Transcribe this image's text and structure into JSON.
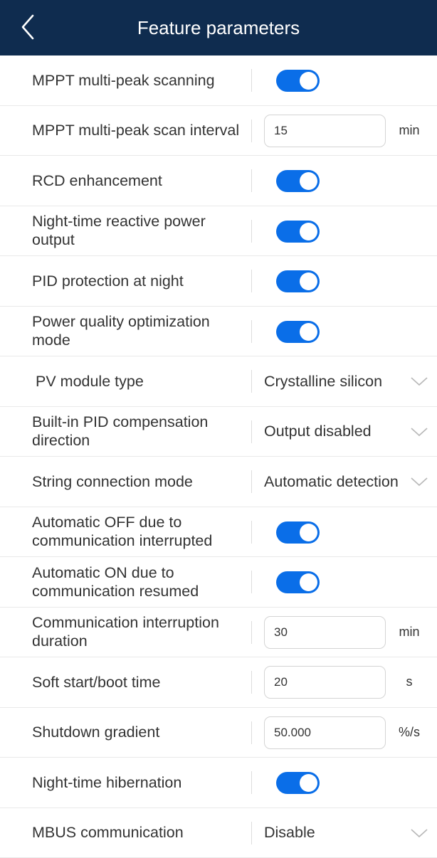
{
  "header": {
    "title": "Feature parameters",
    "back_icon": "chevron-left-icon"
  },
  "colors": {
    "header_bg": "#0f2c4f",
    "toggle_on": "#0a6ee8"
  },
  "rows": [
    {
      "label": "MPPT multi-peak scanning",
      "type": "toggle",
      "on": true
    },
    {
      "label": "MPPT multi-peak scan interval",
      "type": "input",
      "value": "15",
      "unit": "min"
    },
    {
      "label": "RCD enhancement",
      "type": "toggle",
      "on": true
    },
    {
      "label": "Night-time reactive power output",
      "type": "toggle",
      "on": true
    },
    {
      "label": "PID protection at night",
      "type": "toggle",
      "on": true
    },
    {
      "label": "Power quality optimization mode",
      "type": "toggle",
      "on": true
    },
    {
      "label": "PV module type",
      "type": "select",
      "value": "Crystalline silicon"
    },
    {
      "label": "Built-in PID compensation direction",
      "type": "select",
      "value": "Output disabled"
    },
    {
      "label": "String connection mode",
      "type": "select",
      "value": "Automatic detection"
    },
    {
      "label": "Automatic OFF due to communication interrupted",
      "type": "toggle",
      "on": true
    },
    {
      "label": "Automatic ON due to communication resumed",
      "type": "toggle",
      "on": true
    },
    {
      "label": "Communication interruption duration",
      "type": "input",
      "value": "30",
      "unit": "min"
    },
    {
      "label": "Soft start/boot time",
      "type": "input",
      "value": "20",
      "unit": "s"
    },
    {
      "label": "Shutdown gradient",
      "type": "input",
      "value": "50.000",
      "unit": "%/s"
    },
    {
      "label": "Night-time hibernation",
      "type": "toggle",
      "on": true
    },
    {
      "label": "MBUS communication",
      "type": "select",
      "value": "Disable"
    }
  ]
}
